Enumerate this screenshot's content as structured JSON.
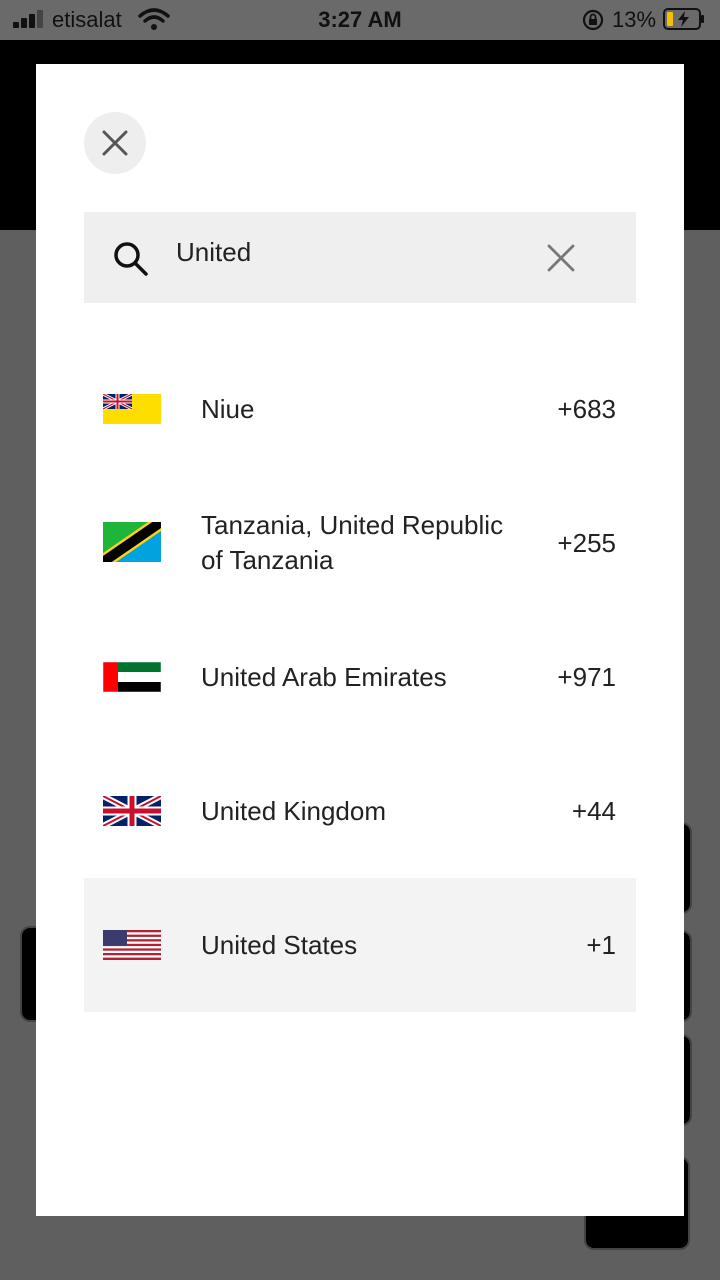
{
  "status": {
    "carrier": "etisalat",
    "time": "3:27 AM",
    "battery": "13%"
  },
  "search": {
    "value": "United",
    "placeholder": ""
  },
  "countries": [
    {
      "name": "Niue",
      "code": "+683",
      "flag": "niue-flag"
    },
    {
      "name": "Tanzania, United Republic of Tanzania",
      "code": "+255",
      "flag": "tanzania-flag"
    },
    {
      "name": "United Arab Emirates",
      "code": "+971",
      "flag": "uae-flag"
    },
    {
      "name": "United Kingdom",
      "code": "+44",
      "flag": "uk-flag"
    },
    {
      "name": "United States",
      "code": "+1",
      "flag": "us-flag",
      "selected": true
    }
  ]
}
